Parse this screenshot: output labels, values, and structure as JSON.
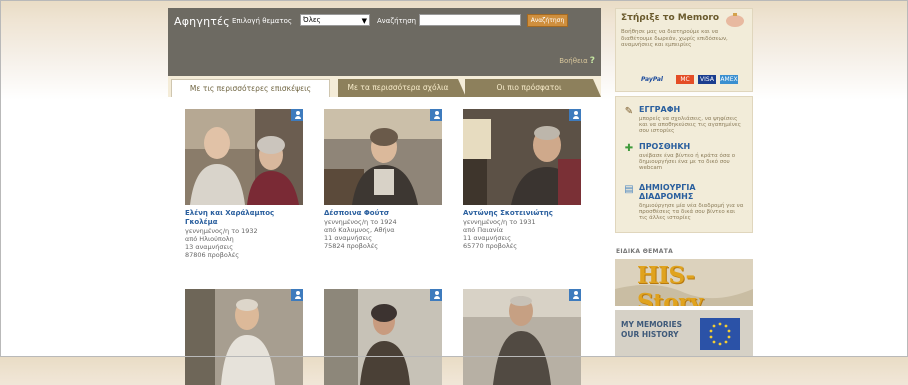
{
  "header": {
    "title": "Αφηγητές",
    "category_label": "Επιλογή θεματος",
    "category_value": "Όλες",
    "search_label": "Αναζήτηση",
    "search_value": "",
    "search_button": "Αναζήτηση",
    "help_label": "Βοήθεια",
    "help_icon": "question-mark"
  },
  "tabs": [
    {
      "label": "Με τις περισσότερες επισκέψεις",
      "active": true
    },
    {
      "label": "Με τα περισσότερα σχόλια",
      "active": false
    },
    {
      "label": "Οι πιο πρόσφατοι",
      "active": false
    }
  ],
  "narrators": [
    {
      "name": "Ελένη και Χαράλαμπος Γκολέμα",
      "lines": [
        "γεννημένος/η το 1932",
        "από Ηλιούπολη",
        "13 αναμνήσεις",
        "87806 προβολές"
      ]
    },
    {
      "name": "Δέσποινα Φούτσ",
      "lines": [
        "γεννημένος/η το 1924",
        "από Καλυμνος, Αθήνα",
        "11 αναμνήσεις",
        "75824 προβολές"
      ]
    },
    {
      "name": "Αντώνης Σκοτεινιώτης",
      "lines": [
        "γεννημένος/η το 1931",
        "από Παιανία",
        "11 αναμνήσεις",
        "65770 προβολές"
      ]
    }
  ],
  "sidebar": {
    "support_title": "Στήριξε το Memoro",
    "support_text": "Βοήθησε μας να διατηρούμε και να διαθέτουμε δωρεάν, χωρίς επιδόσεων, αναμνήσεις και εμπειρίες",
    "payments": [
      "PayPal",
      "MC",
      "VISA",
      "AMEX"
    ],
    "nav": [
      {
        "icon": "pencil-icon",
        "title": "ΕΓΓΡΑΦΗ",
        "desc": "μπορείς να σχολιάσεις, να ψηφίσεις και να αποθηκεύσεις τις αγαπημένες σου ιστορίες"
      },
      {
        "icon": "user-add-icon",
        "title": "ΠΡΟΣΘΗΚΗ",
        "desc": "ανέβασε ένα βίντεο ή κράτα όσα ο δημιουργήσει ένα με το δικό σου webcam"
      },
      {
        "icon": "playlist-icon",
        "title": "ΔΗΜΙΟΥΡΓΙΑ ΔΙΑΔΡΟΜΗΣ",
        "desc": "δημιούργησε μία νέα διαδρομή για να προσθέσεις τα δικά σου βίντεο και τις άλλες ιστορίες"
      }
    ],
    "special_title": "ΕΙΔΙΚΑ ΘΕΜΑΤΑ",
    "banner1_text": "HIS-Story",
    "banner2_text": "MY MEMORIES OUR HISTORY"
  },
  "colors": {
    "header_bg": "#6d6a62",
    "tab_active_bg": "#ffffff",
    "tab_inactive_bg": "#8d805c",
    "link_blue": "#2a5f9e",
    "button_orange": "#cf8f3e"
  }
}
